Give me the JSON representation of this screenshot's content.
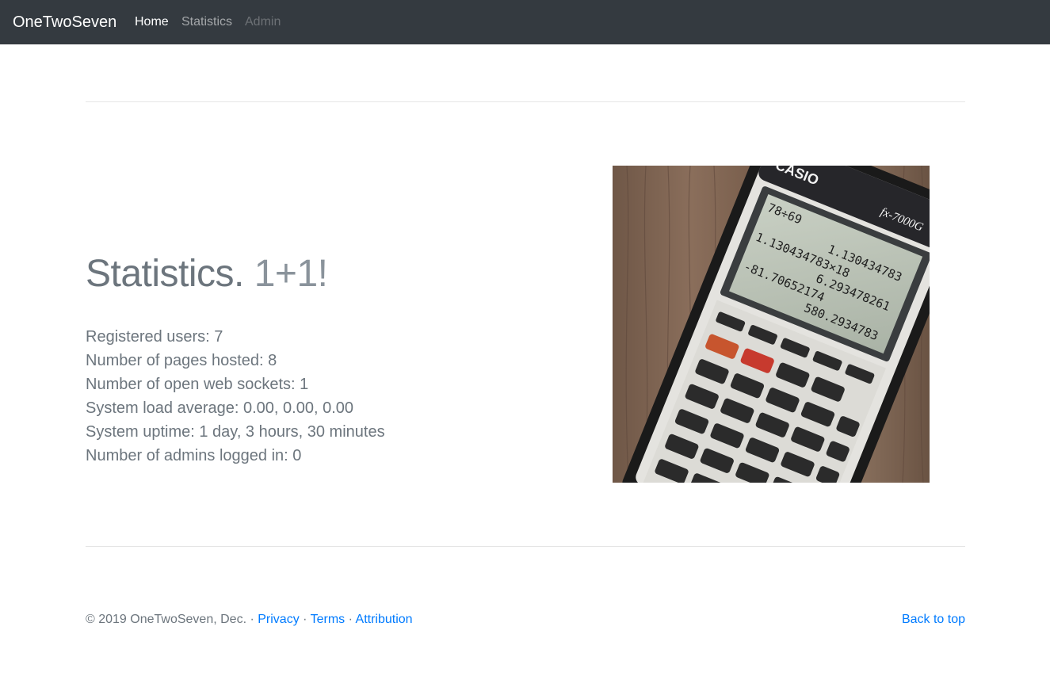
{
  "navbar": {
    "brand": "OneTwoSeven",
    "links": [
      {
        "label": "Home",
        "state": "active"
      },
      {
        "label": "Statistics",
        "state": "normal"
      },
      {
        "label": "Admin",
        "state": "disabled"
      }
    ]
  },
  "main": {
    "heading": "Statistics.",
    "heading_muted": "1+1!",
    "stats": [
      "Registered users: 7",
      "Number of pages hosted: 8",
      "Number of open web sockets: 1",
      "System load average: 0.00, 0.00, 0.00",
      "System uptime: 1 day, 3 hours, 30 minutes",
      "Number of admins logged in: 0"
    ],
    "image": {
      "subject": "calculator-photo",
      "brand_text": "CASIO",
      "model_text": "fx-7000G",
      "screen_lines": [
        "78÷69",
        "1.130434783",
        "1.130434783×18",
        "6.293478261",
        "-81.70652174",
        "580.2934783"
      ]
    }
  },
  "footer": {
    "copyright": "© 2019 OneTwoSeven, Dec. · ",
    "links": [
      "Privacy",
      "Terms",
      "Attribution"
    ],
    "separator": " · ",
    "back_to_top": "Back to top"
  },
  "colors": {
    "navbar_bg": "#343a40",
    "link": "#007bff",
    "muted_text": "#6c757d"
  }
}
